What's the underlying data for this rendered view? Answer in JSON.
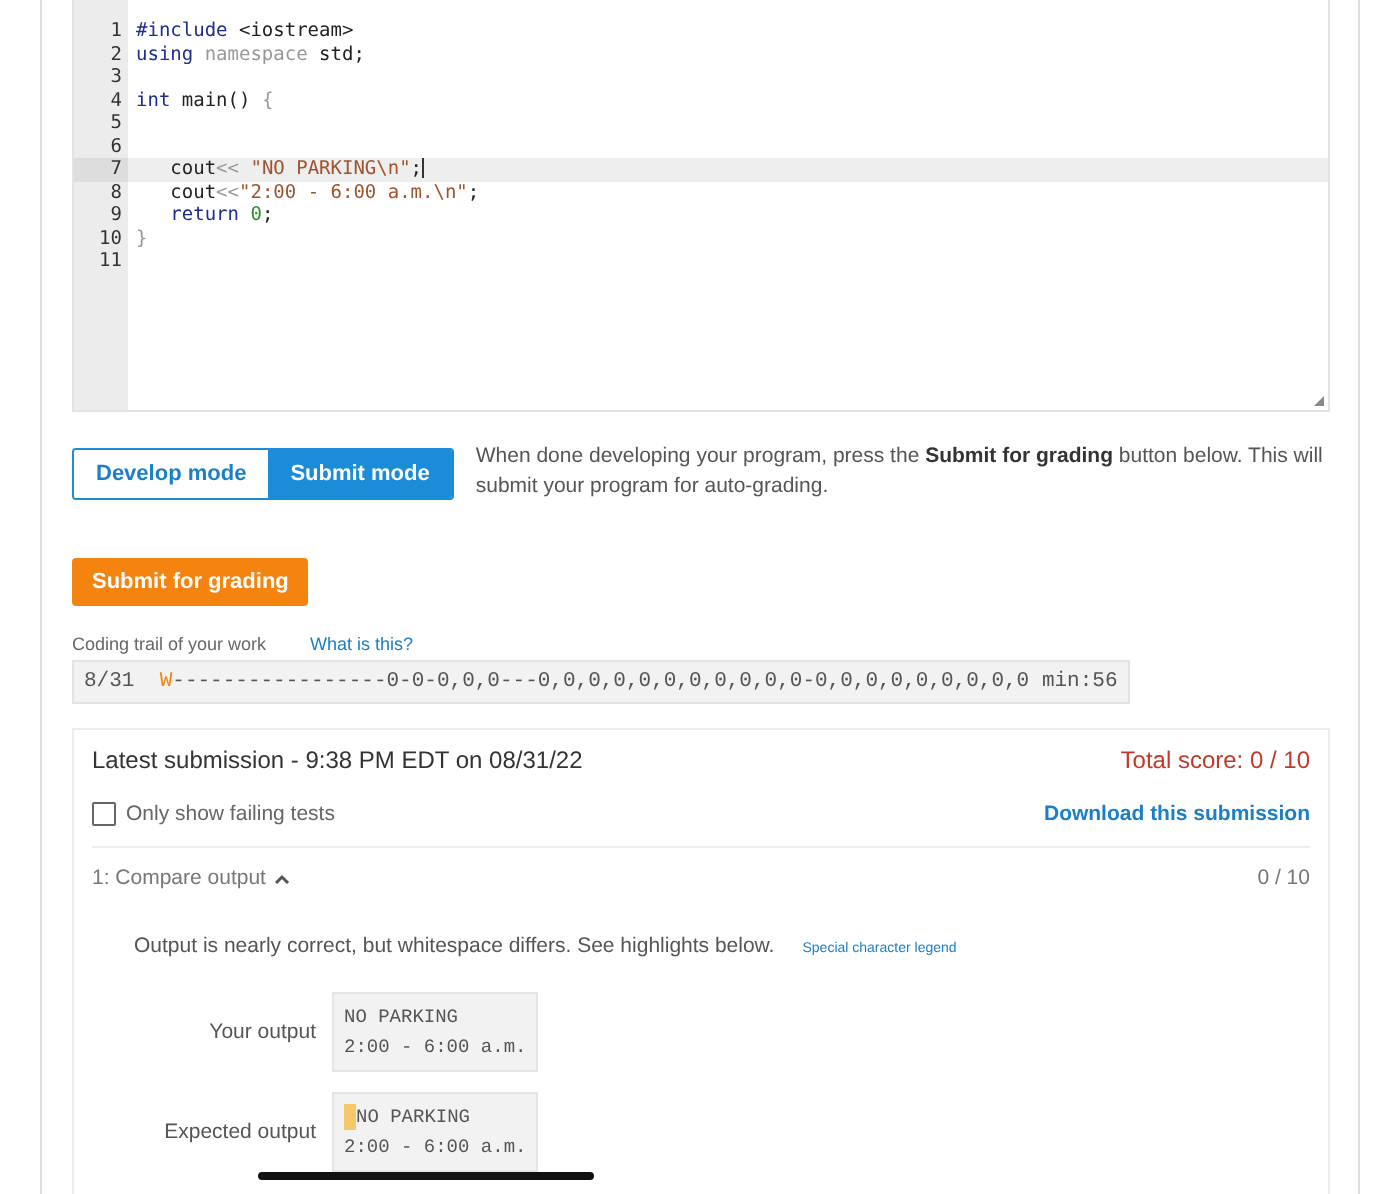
{
  "editor": {
    "lines": [
      {
        "number": "1",
        "active": false,
        "tokens": [
          {
            "text": "#include",
            "kind": "keyword"
          },
          {
            "text": " <iostream>",
            "kind": "plain"
          }
        ]
      },
      {
        "number": "2",
        "active": false,
        "tokens": [
          {
            "text": "using",
            "kind": "keyword"
          },
          {
            "text": " namespace",
            "kind": "muted"
          },
          {
            "text": " std;",
            "kind": "plain"
          }
        ]
      },
      {
        "number": "3",
        "active": false
      },
      {
        "number": "4",
        "active": false,
        "tokens": [
          {
            "text": "int",
            "kind": "keyword"
          },
          {
            "text": " main() ",
            "kind": "plain"
          },
          {
            "text": "{",
            "kind": "muted"
          }
        ]
      },
      {
        "number": "5",
        "active": false
      },
      {
        "number": "6",
        "active": false
      },
      {
        "number": "7",
        "active": true,
        "tokens": [
          {
            "text": "   cout",
            "kind": "plain"
          },
          {
            "text": "<<",
            "kind": "muted"
          },
          {
            "text": " \"NO PARKING\\n\"",
            "kind": "string"
          },
          {
            "text": ";",
            "kind": "plain"
          }
        ]
      },
      {
        "number": "8",
        "active": false,
        "tokens": [
          {
            "text": "   cout",
            "kind": "plain"
          },
          {
            "text": "<<",
            "kind": "muted"
          },
          {
            "text": "\"2:00 - 6:00 a.m.\\n\"",
            "kind": "string"
          },
          {
            "text": ";",
            "kind": "plain"
          }
        ]
      },
      {
        "number": "9",
        "active": false,
        "tokens": [
          {
            "text": "   return",
            "kind": "keyword"
          },
          {
            "text": " 0",
            "kind": "number"
          },
          {
            "text": ";",
            "kind": "plain"
          }
        ]
      },
      {
        "number": "10",
        "active": false,
        "tokens": [
          {
            "text": "}",
            "kind": "muted"
          }
        ]
      },
      {
        "number": "11",
        "active": false
      }
    ]
  },
  "modes": [
    {
      "label": "Develop mode",
      "selected": false
    },
    {
      "label": "Submit mode",
      "selected": true
    }
  ],
  "mode_description": "When done developing your program, press the **Submit for grading** button below. This will submit your program for auto-grading.",
  "submit_button": "Submit for grading",
  "coding_trail": {
    "label": "Coding trail of your work",
    "help_link": "What is this?",
    "date": "8/31",
    "first_mark": "W",
    "trail": "-----------------0-0-0,0,0---0,0,0,0,0,0,0,0,0,0,0-0,0,0,0,0,0,0,0,0",
    "minutes": "min:56"
  },
  "submission": {
    "title": "Latest submission - 9:38 PM EDT on 08/31/22",
    "total_score": "Total score: 0 / 10",
    "filter": {
      "label": "Only show failing tests",
      "checked": false
    },
    "download_link": "Download this submission",
    "tests": [
      {
        "title": "1: Compare output",
        "expanded": true,
        "score": "0 / 10",
        "message": "Output is nearly correct, but whitespace differs. See highlights below.",
        "legend_link": "Special character legend",
        "outputs": [
          {
            "label": "Your output",
            "lines": [
              {
                "text": "NO PARKING",
                "leading_space_highlight": false
              },
              {
                "text": "2:00 - 6:00 a.m.",
                "leading_space_highlight": false
              }
            ]
          },
          {
            "label": "Expected output",
            "lines": [
              {
                "text": "NO PARKING",
                "leading_space_highlight": true
              },
              {
                "text": "2:00 - 6:00 a.m.",
                "leading_space_highlight": false
              }
            ]
          }
        ]
      }
    ]
  }
}
